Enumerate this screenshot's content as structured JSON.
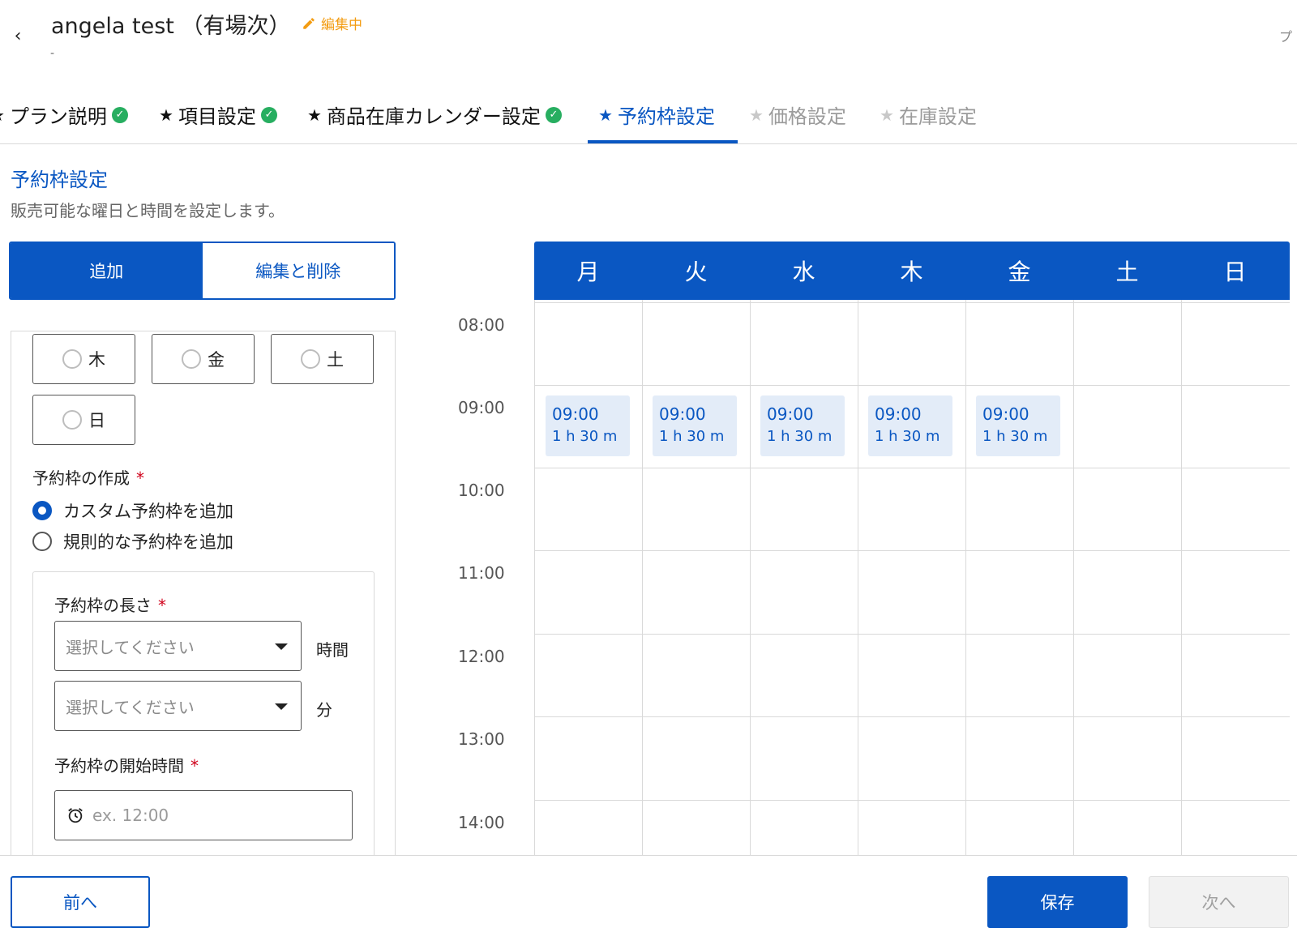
{
  "header": {
    "title": "angela test （有場次）",
    "status": "編集中",
    "subtitle": "-",
    "right_cut": "プ"
  },
  "steps": [
    {
      "label": "プラン説明",
      "state": "done"
    },
    {
      "label": "項目設定",
      "state": "done"
    },
    {
      "label": "商品在庫カレンダー設定",
      "state": "done"
    },
    {
      "label": "予約枠設定",
      "state": "active"
    },
    {
      "label": "価格設定",
      "state": "disabled"
    },
    {
      "label": "在庫設定",
      "state": "disabled"
    }
  ],
  "section": {
    "title": "予約枠設定",
    "description": "販売可能な曜日と時間を設定します。"
  },
  "tabs": {
    "add": "追加",
    "edit_delete": "編集と削除"
  },
  "form": {
    "days": [
      "木",
      "金",
      "土",
      "日"
    ],
    "creation_label": "予約枠の作成",
    "required_mark": "*",
    "options": {
      "custom": "カスタム予約枠を追加",
      "regular": "規則的な予約枠を追加"
    },
    "length_label": "予約枠の長さ",
    "hours_placeholder": "選択してください",
    "hours_unit": "時間",
    "minutes_placeholder": "選択してください",
    "minutes_unit": "分",
    "start_label": "予約枠の開始時間",
    "start_placeholder": "ex. 12:00"
  },
  "calendar": {
    "days": [
      "月",
      "火",
      "水",
      "木",
      "金",
      "土",
      "日"
    ],
    "times": [
      "08:00",
      "09:00",
      "10:00",
      "11:00",
      "12:00",
      "13:00",
      "14:00"
    ],
    "slots": [
      {
        "day": "月",
        "start": "09:00",
        "duration": "1 h 30 m"
      },
      {
        "day": "火",
        "start": "09:00",
        "duration": "1 h 30 m"
      },
      {
        "day": "水",
        "start": "09:00",
        "duration": "1 h 30 m"
      },
      {
        "day": "木",
        "start": "09:00",
        "duration": "1 h 30 m"
      },
      {
        "day": "金",
        "start": "09:00",
        "duration": "1 h 30 m"
      }
    ]
  },
  "footer": {
    "prev": "前へ",
    "save": "保存",
    "next": "次へ"
  },
  "colors": {
    "primary": "#0a57c2",
    "check": "#27ae60",
    "status": "#f39c12",
    "slot_bg": "#e3ecf8"
  }
}
